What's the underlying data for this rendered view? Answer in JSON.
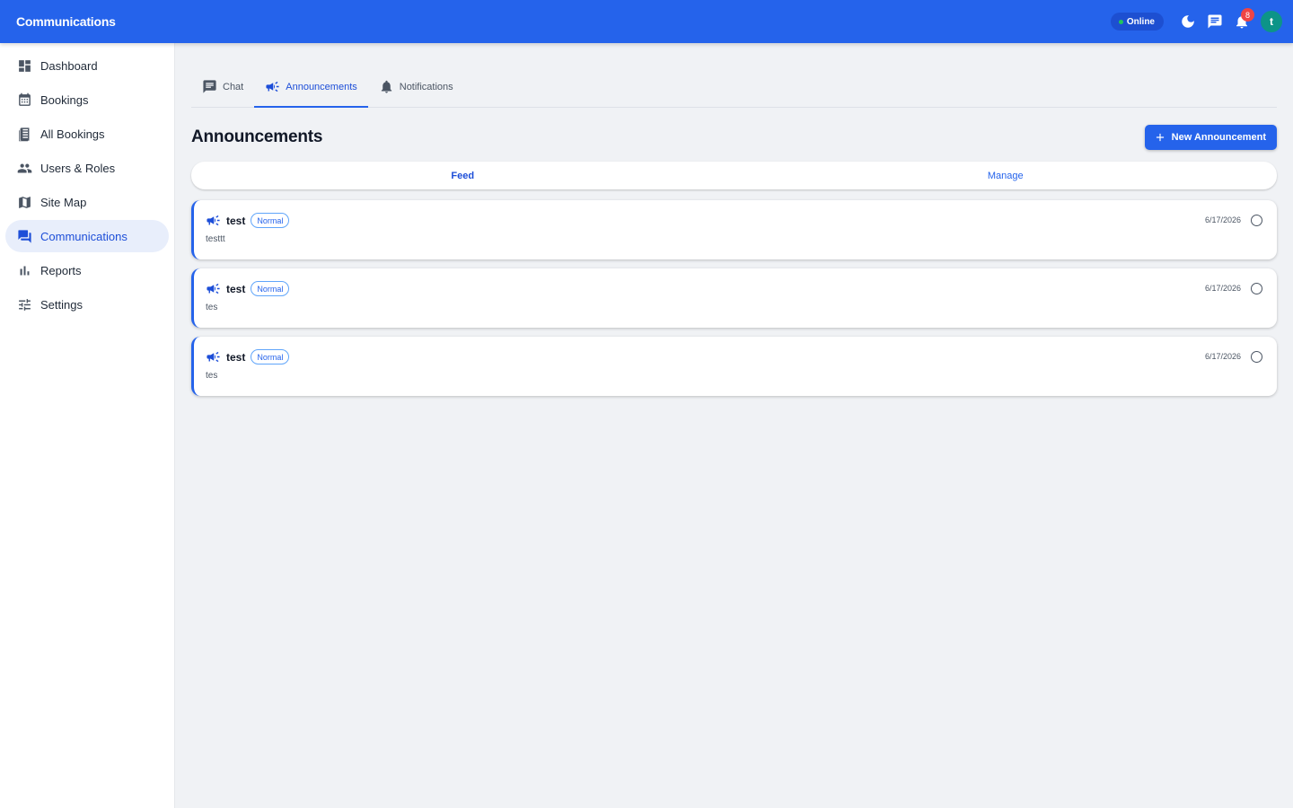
{
  "topbar": {
    "title": "Communications",
    "status_label": "Online",
    "notification_count": "8",
    "avatar_initial": "t"
  },
  "sidebar": {
    "items": [
      {
        "label": "Dashboard",
        "icon": "dashboard-icon"
      },
      {
        "label": "Bookings",
        "icon": "calendar-icon"
      },
      {
        "label": "All Bookings",
        "icon": "receipt-icon"
      },
      {
        "label": "Users & Roles",
        "icon": "people-icon"
      },
      {
        "label": "Site Map",
        "icon": "map-icon"
      },
      {
        "label": "Communications",
        "icon": "forum-icon",
        "active": true
      },
      {
        "label": "Reports",
        "icon": "bar-chart-icon"
      },
      {
        "label": "Settings",
        "icon": "tune-icon"
      }
    ]
  },
  "tabs": [
    {
      "label": "Chat",
      "icon": "chat-icon"
    },
    {
      "label": "Announcements",
      "icon": "campaign-icon",
      "active": true
    },
    {
      "label": "Notifications",
      "icon": "bell-icon"
    }
  ],
  "page": {
    "title": "Announcements",
    "new_button_label": "New Announcement"
  },
  "segments": [
    {
      "label": "Feed",
      "active": true
    },
    {
      "label": "Manage"
    }
  ],
  "announcements": [
    {
      "title": "test",
      "priority": "Normal",
      "body": "testtt",
      "date": "6/17/2026"
    },
    {
      "title": "test",
      "priority": "Normal",
      "body": "tes",
      "date": "6/17/2026"
    },
    {
      "title": "test",
      "priority": "Normal",
      "body": "tes",
      "date": "6/17/2026"
    }
  ],
  "colors": {
    "primary": "#2563eb",
    "online": "#22c55e",
    "badge": "#ef4444",
    "avatar": "#0d9488"
  }
}
